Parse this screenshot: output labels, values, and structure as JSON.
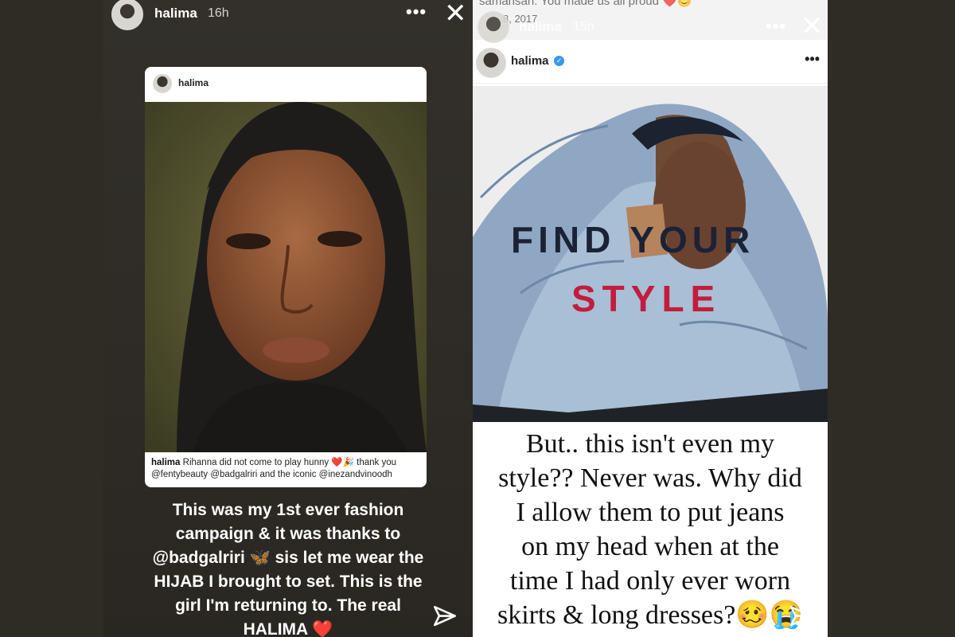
{
  "left_story": {
    "username": "halima",
    "time": "16h",
    "menu_glyph": "•••",
    "close_glyph": "✕",
    "post": {
      "username": "halima",
      "caption_user": "halima",
      "caption_line1": "Rihanna did not come to play hunny ❤️🎉 thank you",
      "caption_line2": "@fentybeauty @badgalriri and the iconic @inezandvinoodh"
    },
    "text_lines": [
      "This was my 1st ever fashion",
      "campaign & it was thanks to",
      "@badgalriri 🦋 sis let me wear the",
      "HIJAB I brought to set. This is the",
      "girl I'm returning to. The real",
      "HALIMA ❤️"
    ],
    "send_icon": "paper-plane-icon"
  },
  "right_story": {
    "ghost_comment": "samansah: You made us all proud ❤️😊",
    "ghost_date": "8, 2017",
    "username": "halima",
    "time": "15h",
    "menu_glyph": "•••",
    "close_glyph": "✕",
    "post": {
      "username": "halima",
      "verified_glyph": "✓",
      "menu_glyph": "•••",
      "headline_1": "FIND YOUR",
      "headline_2": "STYLE"
    },
    "text_lines": [
      "But.. this isn't even my",
      "style?? Never was. Why did",
      "I allow them to put jeans",
      "on my head when at the",
      "time I had only ever worn",
      "skirts & long dresses?🥴😭"
    ],
    "send_icon": "paper-plane-icon"
  },
  "colors": {
    "background": "#2e2a24",
    "find_your": "#1c2236",
    "style": "#c21d3c",
    "verified": "#3897f0"
  }
}
